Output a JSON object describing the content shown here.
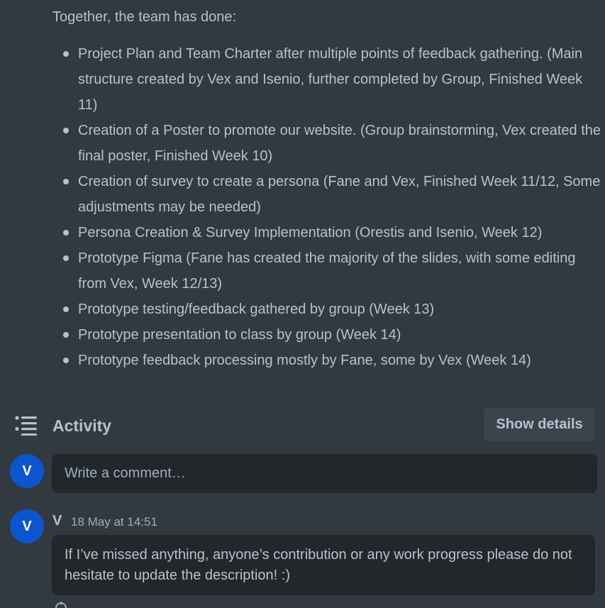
{
  "description": {
    "intro": "Together, the team has done:",
    "items": [
      "Project Plan and Team Charter after multiple points of feedback gathering. (Main structure created by Vex and Isenio, further completed by Group, Finished Week 11)",
      "Creation of a Poster to promote our website. (Group brainstorming, Vex created the final poster, Finished Week 10)",
      "Creation of survey to create a persona (Fane and Vex, Finished Week 11/12, Some adjustments may be needed)",
      "Persona Creation & Survey Implementation (Orestis and Isenio, Week 12)",
      "Prototype Figma (Fane has created the majority of the slides, with some editing from Vex, Week 12/13)",
      "Prototype testing/feedback gathered by group (Week 13)",
      "Prototype presentation to class by group (Week 14)",
      "Prototype feedback processing mostly by Fane, some by Vex (Week 14)"
    ]
  },
  "activity": {
    "icon": "activity-list-icon",
    "title": "Activity",
    "show_details_label": "Show details"
  },
  "composer": {
    "avatar_initial": "V",
    "placeholder": "Write a comment…"
  },
  "comment": {
    "avatar_initial": "V",
    "author": "V",
    "timestamp": "18 May at 14:51",
    "text": "If I’ve missed anything, anyone’s contribution or any work progress please do not hesitate to update the description! :)"
  },
  "colors": {
    "background": "#323940",
    "text": "#b6c2cf",
    "avatar": "#0c55cf",
    "input_background": "#22272b",
    "button_background": "#3b444c"
  }
}
